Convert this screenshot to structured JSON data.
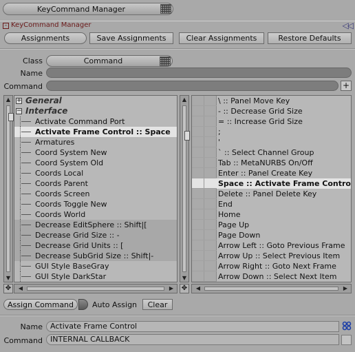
{
  "header": {
    "title": "KeyCommand Manager"
  },
  "panel": {
    "title": "KeyCommand Manager",
    "collapse_glyph": "-",
    "arrows": "◁◁"
  },
  "toolbar": {
    "assignments": "Assignments",
    "save": "Save Assignments",
    "clear": "Clear Assignments",
    "restore": "Restore Defaults"
  },
  "form": {
    "class_label": "Class",
    "class_value": "Command",
    "name_label": "Name",
    "command_label": "Command",
    "add_glyph": "+"
  },
  "commands": {
    "groups": [
      {
        "label": "General",
        "expand": "+"
      },
      {
        "label": "Interface",
        "expand": "−"
      }
    ],
    "items": [
      "Activate Command Port",
      "Activate Frame Control :: Space",
      "Armatures",
      "Coord System New",
      "Coord System Old",
      "Coords Local",
      "Coords Parent",
      "Coords Screen",
      "Coords Toggle New",
      "Coords World",
      "Decrease EditSphere :: Shift|[",
      "Decrease Grid Size :: -",
      "Decrease Grid Units :: [",
      "Decrease SubGrid Size :: Shift|-",
      "GUI Style BaseGray",
      "GUI Style DarkStar"
    ],
    "selected_index": 1
  },
  "keys": {
    "items": [
      "\\ :: Panel Move Key",
      "- :: Decrease Grid Size",
      "= :: Increase Grid Size",
      ";",
      "'",
      "` :: Select Channel Group",
      "Tab :: MetaNURBS On/Off",
      "Enter :: Panel Create Key",
      "Space :: Activate Frame Control",
      "Delete :: Panel Delete Key",
      "End",
      "Home",
      "Page Up",
      "Page Down",
      "Arrow Left :: Goto Previous Frame",
      "Arrow Up :: Select Previous Item",
      "Arrow Right :: Goto Next Frame",
      "Arrow Down :: Select Next Item"
    ],
    "selected_index": 8
  },
  "bottom": {
    "assign_command": "Assign Command",
    "auto_assign": "Auto Assign",
    "clear": "Clear",
    "name_label": "Name",
    "name_value": "Activate Frame Control",
    "command_label": "Command",
    "command_value": "INTERNAL CALLBACK"
  },
  "icons": {
    "grid": "grid-icon",
    "move": "move-icon",
    "chain": "chain-link-icon"
  }
}
